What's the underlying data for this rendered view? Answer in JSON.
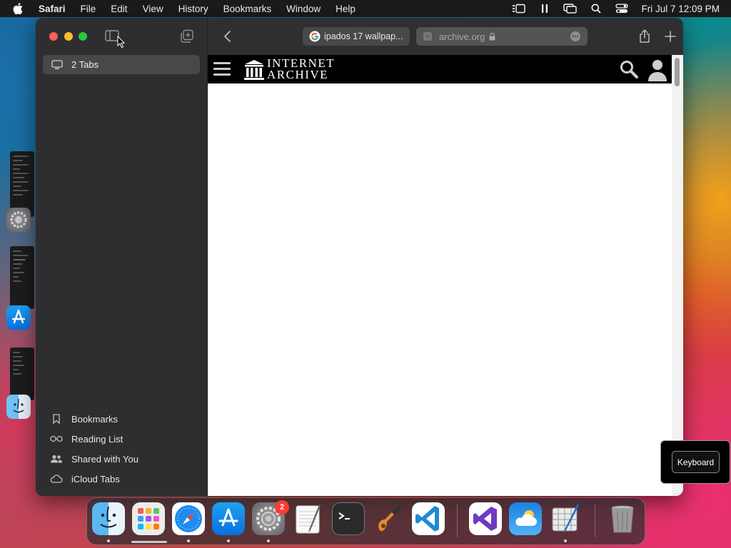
{
  "menubar": {
    "app_name": "Safari",
    "menus": [
      "File",
      "Edit",
      "View",
      "History",
      "Bookmarks",
      "Window",
      "Help"
    ],
    "clock": "Fri Jul 7  12:09 PM",
    "status_icons": [
      "stage-manager-icon",
      "pause-icon",
      "screen-mirroring-icon",
      "spotlight-search-icon",
      "control-center-icon"
    ]
  },
  "sidebar": {
    "tab_group": {
      "label": "2 Tabs",
      "icon": "monitor-icon"
    },
    "links": [
      {
        "label": "Bookmarks",
        "icon": "bookmark-icon"
      },
      {
        "label": "Reading List",
        "icon": "glasses-icon"
      },
      {
        "label": "Shared with You",
        "icon": "people-icon"
      },
      {
        "label": "iCloud Tabs",
        "icon": "cloud-icon"
      }
    ]
  },
  "toolbar": {
    "tabs": [
      {
        "title": "ipados 17 wallpap...",
        "favicon": "google-icon",
        "active": false
      },
      {
        "title": "archive.org",
        "secure": true,
        "active": true
      }
    ]
  },
  "page": {
    "site": "Internet Archive",
    "logo_lines": [
      "INTERNET",
      "ARCHIVE"
    ]
  },
  "keyboard_hud": {
    "label": "Keyboard"
  },
  "dock": {
    "apps": [
      {
        "name": "Finder",
        "running": true
      },
      {
        "name": "Launchpad",
        "running": false
      },
      {
        "name": "Safari",
        "running": true
      },
      {
        "name": "App Store",
        "running": true
      },
      {
        "name": "System Settings",
        "running": true,
        "badge": "2"
      },
      {
        "name": "TextEdit",
        "running": false
      },
      {
        "name": "Terminal",
        "running": false
      },
      {
        "name": "GarageBand",
        "running": false
      },
      {
        "name": "Visual Studio Code",
        "running": false
      },
      {
        "name": "Visual Studio",
        "running": false
      },
      {
        "name": "Weather",
        "running": false
      },
      {
        "name": "Xcode Instruments",
        "running": true
      },
      {
        "name": "Trash",
        "running": false
      }
    ]
  },
  "colors": {
    "menubar": "#1b1b1d",
    "sidebar": "#2e2e30",
    "close": "#ff5f57",
    "minimize": "#febc2e",
    "zoom": "#28c840",
    "badge": "#ff3b30"
  }
}
